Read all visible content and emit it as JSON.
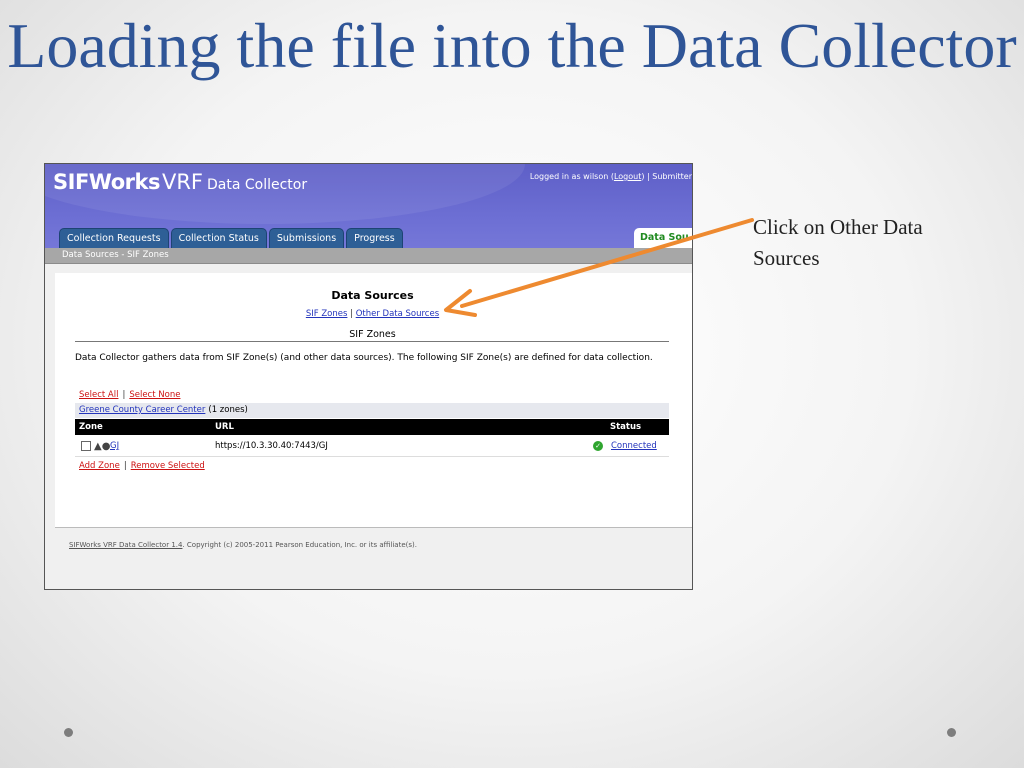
{
  "slide": {
    "title": "Loading the file into the Data Collector",
    "note": "Click on Other Data Sources"
  },
  "app": {
    "logo_bold": "SIFWorks",
    "logo_thin": "VRF",
    "logo_sub": "Data Collector",
    "login_prefix": "Logged in as wilson (",
    "logout_label": "Logout",
    "login_suffix": ")   |   Submitter",
    "tabs": [
      "Collection Requests",
      "Collection Status",
      "Submissions",
      "Progress"
    ],
    "active_tab": "Data Sou",
    "breadcrumb": "Data Sources - SIF Zones"
  },
  "content": {
    "title": "Data Sources",
    "link_sif_zones": "SIF Zones",
    "link_separator": "|",
    "link_other": "Other Data Sources",
    "section_title": "SIF Zones",
    "intro": "Data Collector gathers data from SIF Zone(s) (and other data sources). The following SIF Zone(s) are defined for data collection.",
    "select_all": "Select All",
    "select_none": "Select None",
    "group_name": "Greene County Career Center",
    "group_count": "(1 zones)",
    "columns": {
      "zone": "Zone",
      "url": "URL",
      "status": "Status"
    },
    "rows": [
      {
        "zone": "GJ",
        "url": "https://10.3.30.40:7443/GJ",
        "status": "Connected"
      }
    ],
    "add_zone": "Add Zone",
    "remove_selected": "Remove Selected"
  },
  "footer": {
    "product_link": "SIFWorks VRF Data Collector 1.4",
    "copyright": ". Copyright (c) 2005-2011 Pearson Education, Inc. or its affiliate(s)."
  },
  "colors": {
    "title": "#2f5597",
    "header": "#6c6ed3",
    "tab": "#2e5f96",
    "arrow": "#ee8a30",
    "status_ok": "#2fa52f",
    "link_red": "#cc1111"
  }
}
